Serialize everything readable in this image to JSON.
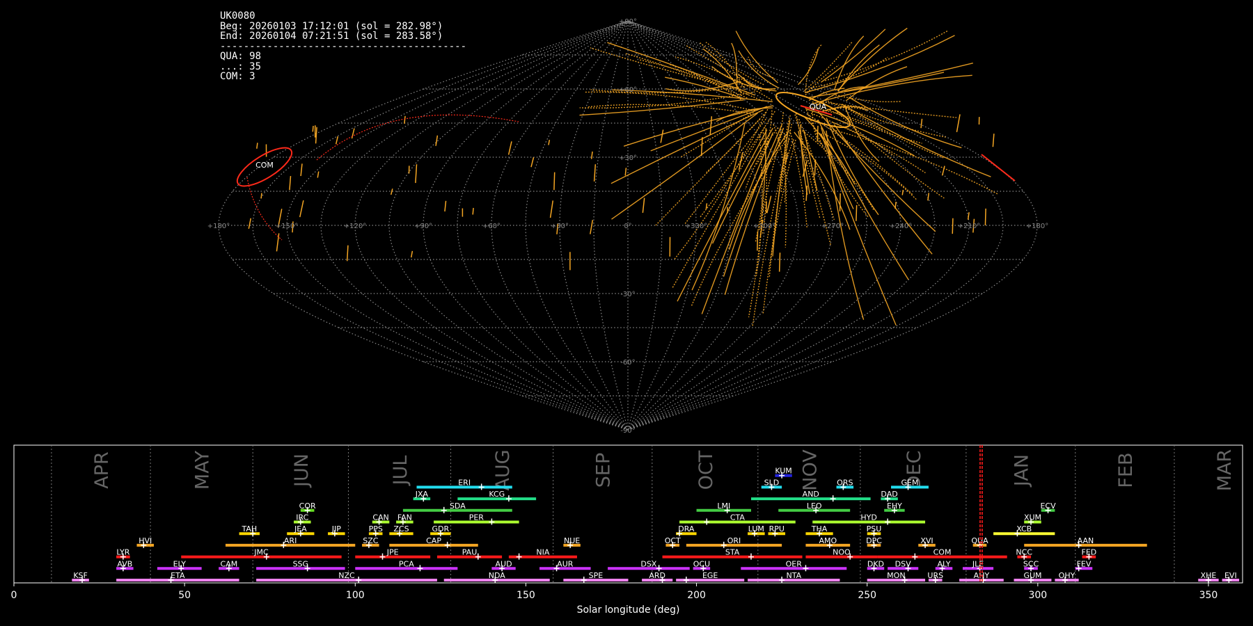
{
  "header": {
    "station": "UK0080",
    "begin": "Beg: 20260103 17:12:01 (sol = 282.98°)",
    "end": "End: 20260104 07:21:51 (sol = 283.58°)",
    "divider": "------------------------------------------",
    "counts": [
      "QUA: 98",
      "...: 35",
      "COM: 3"
    ]
  },
  "sky_map": {
    "lat_labels": [
      "+90°",
      "+60°",
      "+30°",
      "0°",
      "-30°",
      "-60°",
      "-90°"
    ],
    "lon_labels": [
      "+180°",
      "+150°",
      "+120°",
      "+90°",
      "+60°",
      "+30°",
      "0°",
      "+330°",
      "+300°",
      "+270°",
      "+240°",
      "+210°",
      "+180°"
    ],
    "radiant_labels": [
      {
        "name": "QUA",
        "lon": 285,
        "lat": 47
      },
      {
        "name": "COM",
        "lon": 160,
        "lat": 19
      }
    ],
    "colors": {
      "trail": "#f5a623",
      "shower": "#ff2a1a",
      "grid": "#8a8a8a"
    }
  },
  "chart_data": {
    "type": "bar",
    "xlabel": "Solar longitude (deg)",
    "xlim": [
      0,
      360
    ],
    "xticks": [
      0,
      50,
      100,
      150,
      200,
      250,
      300,
      350
    ],
    "marker_sol": 283.3,
    "months": [
      {
        "label": "APR",
        "start": 11
      },
      {
        "label": "MAY",
        "start": 40
      },
      {
        "label": "JUN",
        "start": 70
      },
      {
        "label": "JUL",
        "start": 98
      },
      {
        "label": "AUG",
        "start": 128
      },
      {
        "label": "SEP",
        "start": 158
      },
      {
        "label": "OCT",
        "start": 187
      },
      {
        "label": "NOV",
        "start": 218
      },
      {
        "label": "DEC",
        "start": 248
      },
      {
        "label": "JAN",
        "start": 279
      },
      {
        "label": "FEB",
        "start": 311
      },
      {
        "label": "MAR",
        "start": 340
      }
    ],
    "showers": [
      {
        "code": "KSF",
        "start": 17,
        "end": 22,
        "peak": 20,
        "row": 0,
        "color": "#ee82ee"
      },
      {
        "code": "ETA",
        "start": 30,
        "end": 66,
        "peak": 46,
        "row": 0,
        "color": "#ee82ee"
      },
      {
        "code": "NZC",
        "start": 71,
        "end": 124,
        "peak": 101,
        "row": 0,
        "color": "#ee82ee"
      },
      {
        "code": "NDA",
        "start": 126,
        "end": 157,
        "peak": 141,
        "row": 0,
        "color": "#ee82ee"
      },
      {
        "code": "SPE",
        "start": 161,
        "end": 180,
        "peak": 167,
        "row": 0,
        "color": "#ee82ee"
      },
      {
        "code": "ARD",
        "start": 184,
        "end": 193,
        "peak": 190,
        "row": 0,
        "color": "#ee82ee"
      },
      {
        "code": "EGE",
        "start": 194,
        "end": 214,
        "peak": 197,
        "row": 0,
        "color": "#ee82ee"
      },
      {
        "code": "NTA",
        "start": 215,
        "end": 242,
        "peak": 225,
        "row": 0,
        "color": "#ee82ee"
      },
      {
        "code": "MON",
        "start": 250,
        "end": 267,
        "peak": 261,
        "row": 0,
        "color": "#ee82ee"
      },
      {
        "code": "URS",
        "start": 268,
        "end": 272,
        "peak": 270,
        "row": 0,
        "color": "#ee82ee"
      },
      {
        "code": "AHY",
        "start": 277,
        "end": 290,
        "peak": 284,
        "row": 0,
        "color": "#ee82ee"
      },
      {
        "code": "GUM",
        "start": 293,
        "end": 304,
        "peak": 298,
        "row": 0,
        "color": "#ee82ee"
      },
      {
        "code": "OHY",
        "start": 305,
        "end": 312,
        "peak": 308,
        "row": 0,
        "color": "#ee82ee"
      },
      {
        "code": "XHE",
        "start": 347,
        "end": 353,
        "peak": 350,
        "row": 0,
        "color": "#ee82ee"
      },
      {
        "code": "EVI",
        "start": 354,
        "end": 359,
        "peak": 356,
        "row": 0,
        "color": "#ee82ee"
      },
      {
        "code": "AVB",
        "start": 30,
        "end": 35,
        "peak": 32,
        "row": 1,
        "color": "#cc33ff"
      },
      {
        "code": "ELY",
        "start": 42,
        "end": 55,
        "peak": 49,
        "row": 1,
        "color": "#cc33ff"
      },
      {
        "code": "CAM",
        "start": 60,
        "end": 66,
        "peak": 63,
        "row": 1,
        "color": "#cc33ff"
      },
      {
        "code": "SSG",
        "start": 71,
        "end": 97,
        "peak": 86,
        "row": 1,
        "color": "#cc33ff"
      },
      {
        "code": "PCA",
        "start": 100,
        "end": 130,
        "peak": 119,
        "row": 1,
        "color": "#cc33ff"
      },
      {
        "code": "AUD",
        "start": 140,
        "end": 147,
        "peak": 143,
        "row": 1,
        "color": "#cc33ff"
      },
      {
        "code": "AUR",
        "start": 154,
        "end": 169,
        "peak": 159,
        "row": 1,
        "color": "#cc33ff"
      },
      {
        "code": "DSX",
        "start": 174,
        "end": 198,
        "peak": 189,
        "row": 1,
        "color": "#cc33ff"
      },
      {
        "code": "OCU",
        "start": 199,
        "end": 204,
        "peak": 202,
        "row": 1,
        "color": "#cc33ff"
      },
      {
        "code": "OER",
        "start": 213,
        "end": 244,
        "peak": 232,
        "row": 1,
        "color": "#cc33ff"
      },
      {
        "code": "DKD",
        "start": 250,
        "end": 255,
        "peak": 252,
        "row": 1,
        "color": "#cc33ff"
      },
      {
        "code": "DSV",
        "start": 256,
        "end": 265,
        "peak": 262,
        "row": 1,
        "color": "#cc33ff"
      },
      {
        "code": "ALY",
        "start": 270,
        "end": 275,
        "peak": 272,
        "row": 1,
        "color": "#cc33ff"
      },
      {
        "code": "JLE",
        "start": 278,
        "end": 287,
        "peak": 283,
        "row": 1,
        "color": "#cc33ff"
      },
      {
        "code": "SCC",
        "start": 296,
        "end": 300,
        "peak": 298,
        "row": 1,
        "color": "#cc33ff"
      },
      {
        "code": "FEV",
        "start": 311,
        "end": 316,
        "peak": 312,
        "row": 1,
        "color": "#cc33ff"
      },
      {
        "code": "LYR",
        "start": 30,
        "end": 34,
        "peak": 32,
        "row": 2,
        "color": "#ff1a1a"
      },
      {
        "code": "JMC",
        "start": 49,
        "end": 96,
        "peak": 74,
        "row": 2,
        "color": "#ff1a1a"
      },
      {
        "code": "JPE",
        "start": 100,
        "end": 122,
        "peak": 108,
        "row": 2,
        "color": "#ff1a1a"
      },
      {
        "code": "PAU",
        "start": 124,
        "end": 143,
        "peak": 136,
        "row": 2,
        "color": "#ff1a1a"
      },
      {
        "code": "NIA",
        "start": 145,
        "end": 165,
        "peak": 148,
        "row": 2,
        "color": "#ff1a1a"
      },
      {
        "code": "STA",
        "start": 190,
        "end": 231,
        "peak": 216,
        "row": 2,
        "color": "#ff1a1a"
      },
      {
        "code": "NOO",
        "start": 232,
        "end": 253,
        "peak": 245,
        "row": 2,
        "color": "#ff1a1a"
      },
      {
        "code": "COM",
        "start": 253,
        "end": 291,
        "peak": 264,
        "row": 2,
        "color": "#ff1a1a"
      },
      {
        "code": "NCC",
        "start": 294,
        "end": 298,
        "peak": 296,
        "row": 2,
        "color": "#ff1a1a"
      },
      {
        "code": "FED",
        "start": 313,
        "end": 317,
        "peak": 315,
        "row": 2,
        "color": "#ff1a1a"
      },
      {
        "code": "HVI",
        "start": 36,
        "end": 41,
        "peak": 38,
        "row": 3,
        "color": "#f5a623"
      },
      {
        "code": "ARI",
        "start": 62,
        "end": 100,
        "peak": 79,
        "row": 3,
        "color": "#f5a623"
      },
      {
        "code": "SZC",
        "start": 102,
        "end": 107,
        "peak": 104,
        "row": 3,
        "color": "#f5a623"
      },
      {
        "code": "CAP",
        "start": 110,
        "end": 136,
        "peak": 127,
        "row": 3,
        "color": "#f5a623"
      },
      {
        "code": "NUE",
        "start": 161,
        "end": 166,
        "peak": 163,
        "row": 3,
        "color": "#f5a623"
      },
      {
        "code": "OCT",
        "start": 191,
        "end": 195,
        "peak": 193,
        "row": 3,
        "color": "#f5a623"
      },
      {
        "code": "ORI",
        "start": 197,
        "end": 225,
        "peak": 208,
        "row": 3,
        "color": "#f5a623"
      },
      {
        "code": "AMO",
        "start": 232,
        "end": 245,
        "peak": 239,
        "row": 3,
        "color": "#f5a623"
      },
      {
        "code": "DPC",
        "start": 250,
        "end": 254,
        "peak": 252,
        "row": 3,
        "color": "#f5a623"
      },
      {
        "code": "XVI",
        "start": 265,
        "end": 270,
        "peak": 267,
        "row": 3,
        "color": "#f5a623"
      },
      {
        "code": "QUA",
        "start": 281,
        "end": 285,
        "peak": 283,
        "row": 3,
        "color": "#f5a623"
      },
      {
        "code": "AAN",
        "start": 296,
        "end": 332,
        "peak": 312,
        "row": 3,
        "color": "#f5a623"
      },
      {
        "code": "TAH",
        "start": 66,
        "end": 72,
        "peak": 70,
        "row": 4,
        "color": "#ffd700"
      },
      {
        "code": "JEA",
        "start": 80,
        "end": 88,
        "peak": 84,
        "row": 4,
        "color": "#ffd700"
      },
      {
        "code": "JIP",
        "start": 92,
        "end": 97,
        "peak": 94,
        "row": 4,
        "color": "#ffd700"
      },
      {
        "code": "PPS",
        "start": 104,
        "end": 108,
        "peak": 106,
        "row": 4,
        "color": "#ffd700"
      },
      {
        "code": "ZCS",
        "start": 110,
        "end": 117,
        "peak": 113,
        "row": 4,
        "color": "#ffd700"
      },
      {
        "code": "GDR",
        "start": 122,
        "end": 128,
        "peak": 125,
        "row": 4,
        "color": "#ffd700"
      },
      {
        "code": "DRA",
        "start": 194,
        "end": 200,
        "peak": 195,
        "row": 4,
        "color": "#ffd700"
      },
      {
        "code": "LUM",
        "start": 215,
        "end": 220,
        "peak": 217,
        "row": 4,
        "color": "#ffd700"
      },
      {
        "code": "RPU",
        "start": 221,
        "end": 226,
        "peak": 223,
        "row": 4,
        "color": "#ffd700"
      },
      {
        "code": "THA",
        "start": 232,
        "end": 240,
        "peak": 236,
        "row": 4,
        "color": "#ffd700"
      },
      {
        "code": "PSU",
        "start": 250,
        "end": 254,
        "peak": 252,
        "row": 4,
        "color": "#ffd700"
      },
      {
        "code": "XCB",
        "start": 287,
        "end": 305,
        "peak": 294,
        "row": 4,
        "color": "#ffff33"
      },
      {
        "code": "IRC",
        "start": 82,
        "end": 87,
        "peak": 84,
        "row": 5,
        "color": "#adff2f"
      },
      {
        "code": "CAN",
        "start": 105,
        "end": 110,
        "peak": 107,
        "row": 5,
        "color": "#adff2f"
      },
      {
        "code": "FAN",
        "start": 112,
        "end": 117,
        "peak": 114,
        "row": 5,
        "color": "#adff2f"
      },
      {
        "code": "PER",
        "start": 123,
        "end": 148,
        "peak": 140,
        "row": 5,
        "color": "#adff2f"
      },
      {
        "code": "CTA",
        "start": 195,
        "end": 229,
        "peak": 203,
        "row": 5,
        "color": "#adff2f"
      },
      {
        "code": "HYD",
        "start": 234,
        "end": 267,
        "peak": 256,
        "row": 5,
        "color": "#adff2f"
      },
      {
        "code": "XUM",
        "start": 296,
        "end": 301,
        "peak": 298,
        "row": 5,
        "color": "#adff2f"
      },
      {
        "code": "COR",
        "start": 84,
        "end": 88,
        "peak": 86,
        "row": 6,
        "color": "#66dd22"
      },
      {
        "code": "SDA",
        "start": 114,
        "end": 146,
        "peak": 126,
        "row": 6,
        "color": "#44cc44"
      },
      {
        "code": "LMI",
        "start": 200,
        "end": 216,
        "peak": 209,
        "row": 6,
        "color": "#44cc44"
      },
      {
        "code": "LEO",
        "start": 224,
        "end": 245,
        "peak": 235,
        "row": 6,
        "color": "#44cc44"
      },
      {
        "code": "EHY",
        "start": 255,
        "end": 261,
        "peak": 258,
        "row": 6,
        "color": "#44cc44"
      },
      {
        "code": "ECV",
        "start": 301,
        "end": 305,
        "peak": 303,
        "row": 6,
        "color": "#44cc44"
      },
      {
        "code": "JXA",
        "start": 117,
        "end": 122,
        "peak": 120,
        "row": 7,
        "color": "#22dd88"
      },
      {
        "code": "KCG",
        "start": 130,
        "end": 153,
        "peak": 145,
        "row": 7,
        "color": "#22dd88"
      },
      {
        "code": "AND",
        "start": 216,
        "end": 251,
        "peak": 240,
        "row": 7,
        "color": "#22dd88"
      },
      {
        "code": "DAD",
        "start": 254,
        "end": 259,
        "peak": 256,
        "row": 7,
        "color": "#22dd88"
      },
      {
        "code": "ERI",
        "start": 118,
        "end": 146,
        "peak": 137,
        "row": 8,
        "color": "#22ddee"
      },
      {
        "code": "SLD",
        "start": 219,
        "end": 225,
        "peak": 222,
        "row": 8,
        "color": "#22ddee"
      },
      {
        "code": "ORS",
        "start": 241,
        "end": 246,
        "peak": 243,
        "row": 8,
        "color": "#22ddee"
      },
      {
        "code": "GEM",
        "start": 257,
        "end": 268,
        "peak": 262,
        "row": 8,
        "color": "#22ddee"
      },
      {
        "code": "KUM",
        "start": 223,
        "end": 228,
        "peak": 225,
        "row": 9,
        "color": "#2222dd"
      }
    ]
  }
}
